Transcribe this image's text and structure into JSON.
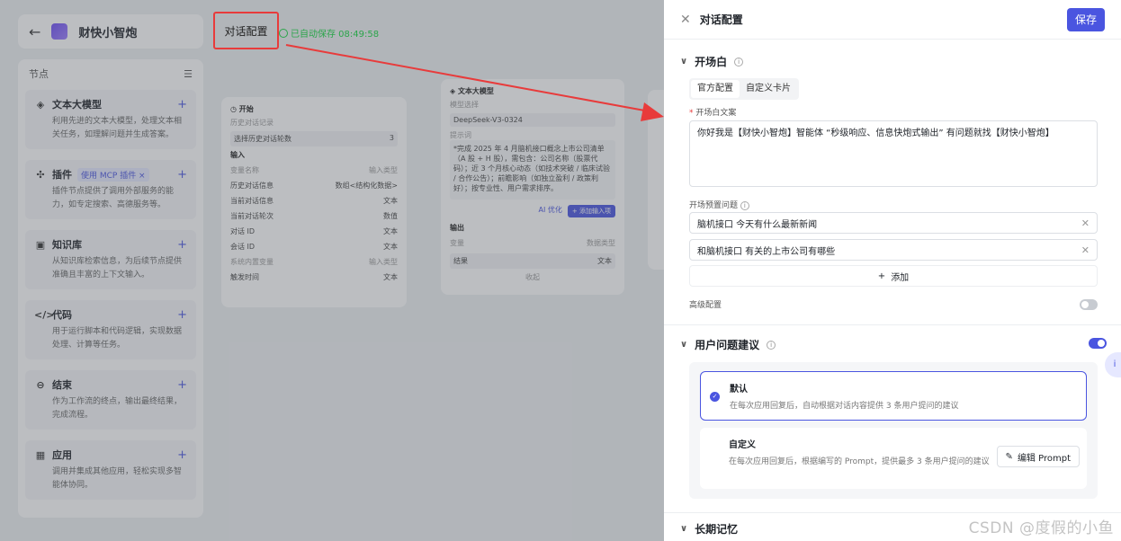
{
  "app": {
    "name": "财快小智炮"
  },
  "topbar": {
    "tab_label": "对话配置",
    "autosave_text": "已自动保存 08:49:58"
  },
  "node_panel": {
    "title": "节点",
    "items": [
      {
        "title": "文本大模型",
        "desc": "利用先进的文本大模型，处理文本相关任务，如理解问题并生成答案。"
      },
      {
        "title": "插件",
        "tag": "使用 MCP 插件 ×",
        "desc": "插件节点提供了调用外部服务的能力，如专定搜索、高德服务等。"
      },
      {
        "title": "知识库",
        "desc": "从知识库检索信息，为后续节点提供准确且丰富的上下文输入。"
      },
      {
        "title": "代码",
        "desc": "用于运行脚本和代码逻辑，实现数据处理、计算等任务。"
      },
      {
        "title": "结束",
        "desc": "作为工作流的终点，输出最终结果，完成流程。"
      },
      {
        "title": "应用",
        "desc": "调用并集成其他应用，轻松实现多智能体协同。"
      }
    ]
  },
  "canvas": {
    "start": {
      "title": "开始",
      "history": "历史对话记录",
      "rounds_label": "选择历史对话轮数",
      "rounds_value": "3",
      "input_title": "输入",
      "col_name": "变量名称",
      "col_type": "输入类型",
      "rows": [
        {
          "name": "历史对话信息",
          "type": "数组<结构化数据>"
        },
        {
          "name": "当前对话信息",
          "type": "文本"
        },
        {
          "name": "当前对话轮次",
          "type": "数值"
        },
        {
          "name": "对话 ID",
          "type": "文本"
        },
        {
          "name": "会话 ID",
          "type": "文本"
        }
      ],
      "system_title": "系统内置变量",
      "system_type": "输入类型",
      "system_row": {
        "name": "触发时间",
        "type": "文本"
      }
    },
    "llm": {
      "title": "文本大模型",
      "model_label": "模型选择",
      "model_value": "DeepSeek-V3-0324",
      "prompt_label": "提示词",
      "prompt_text": "*完成 2025 年 4 月脑机接口概念上市公司清单（A 股 + H 股），需包含：公司名称（股票代码）；近 3 个月核心动态（如技术突破 / 临床试验 / 合作公告）；前瞻影响（如独立盈利 / 政策利好）；按专业性、用户需求排序。",
      "ai_btn": "AI 优化",
      "add_input_btn": "+ 添加输入项",
      "output_title": "输出",
      "out_col_name": "变量",
      "out_col_type": "数据类型",
      "out_row": {
        "name": "结果",
        "type": "文本"
      },
      "fold": "收起"
    }
  },
  "drawer": {
    "title": "对话配置",
    "save": "保存",
    "opening": {
      "title": "开场白",
      "tabs": [
        "官方配置",
        "自定义卡片"
      ],
      "text_label": "开场白文案",
      "text": "你好我是【财快小智炮】智能体 “秒级响应、信息快炮式输出” 有问题就找【财快小智炮】",
      "preset_label": "开场预置问题",
      "presets": [
        "脑机接口 今天有什么最新新闻",
        "和脑机接口 有关的上市公司有哪些"
      ],
      "add": "添加",
      "advanced": "高级配置"
    },
    "suggest": {
      "title": "用户问题建议",
      "options": [
        {
          "title": "默认",
          "desc": "在每次应用回复后，自动根据对话内容提供 3 条用户提问的建议"
        },
        {
          "title": "自定义",
          "desc": "在每次应用回复后，根据编写的 Prompt，提供最多 3 条用户提问的建议"
        }
      ],
      "edit_prompt": "编辑 Prompt"
    },
    "memory": {
      "title": "长期记忆"
    }
  },
  "watermark": "CSDN @度假的小鱼",
  "colors": {
    "accent": "#4a55e0",
    "annotation": "#e83b3b"
  }
}
